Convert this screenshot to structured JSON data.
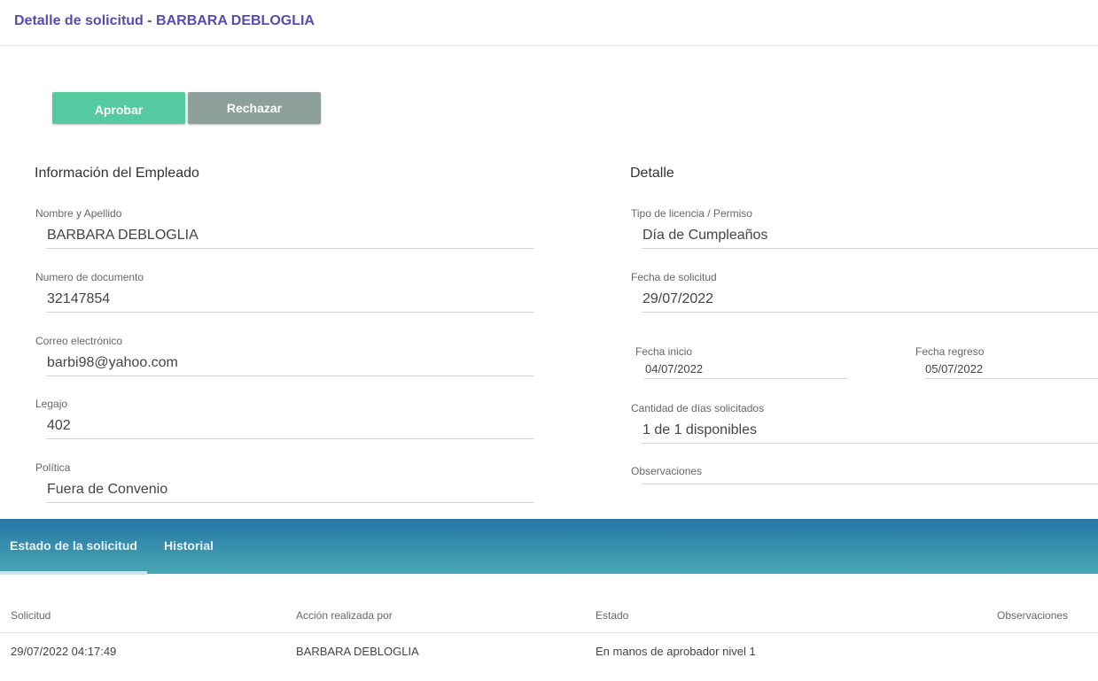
{
  "header": {
    "title": "Detalle de solicitud - BARBARA DEBLOGLIA"
  },
  "actions": {
    "approve_label": "Aprobar",
    "reject_label": "Rechazar"
  },
  "employee": {
    "section_title": "Información del Empleado",
    "name_label": "Nombre y Apellido",
    "name_value": "BARBARA DEBLOGLIA",
    "document_label": "Numero de documento",
    "document_value": "32147854",
    "email_label": "Correo electrónico",
    "email_value": "barbi98@yahoo.com",
    "legajo_label": "Legajo",
    "legajo_value": "402",
    "policy_label": "Política",
    "policy_value": "Fuera de Convenio"
  },
  "detail": {
    "section_title": "Detalle",
    "type_label": "Tipo de licencia / Permiso",
    "type_value": "Día de Cumpleaños",
    "request_date_label": "Fecha de solicitud",
    "request_date_value": "29/07/2022",
    "start_label": "Fecha inicio",
    "start_value": "04/07/2022",
    "return_label": "Fecha regreso",
    "return_value": "05/07/2022",
    "days_label": "Cantidad de días solicitados",
    "days_value": "1 de 1 disponibles",
    "obs_label": "Observaciones",
    "obs_value": ""
  },
  "tabs": [
    {
      "label": "Estado de la solicitud",
      "active": true
    },
    {
      "label": "Historial",
      "active": false
    }
  ],
  "status_table": {
    "columns": [
      "Solicitud",
      "Acción realizada por",
      "Estado",
      "Observaciones"
    ],
    "rows": [
      [
        "29/07/2022 04:17:49",
        "BARBARA DEBLOGLIA",
        "En manos de aprobador nivel 1",
        ""
      ]
    ]
  },
  "colors": {
    "title": "#5a4ab0",
    "approve": "#55c9a0",
    "reject": "#8da09c",
    "tabs_bar": "#2f86aa"
  }
}
